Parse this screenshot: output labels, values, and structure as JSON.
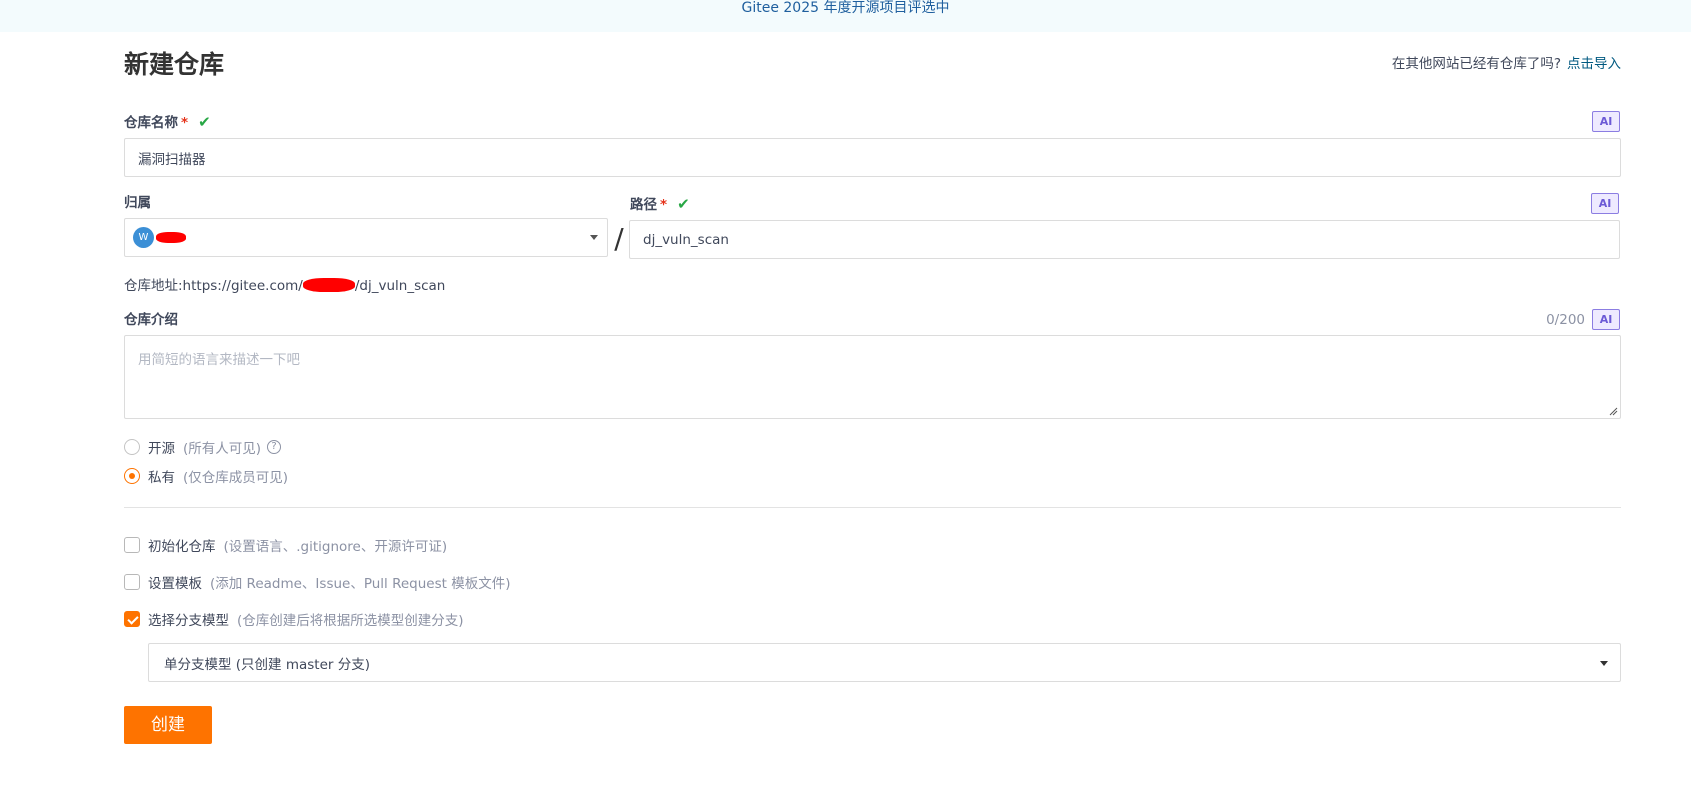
{
  "banner": {
    "text": "Gitee 2025 年度开源项目评选中"
  },
  "page": {
    "title": "新建仓库"
  },
  "import_hint": {
    "text": "在其他网站已经有仓库了吗?",
    "link": "点击导入"
  },
  "ai_badge": "AI",
  "repo_name": {
    "label": "仓库名称",
    "required_mark": "*",
    "check": "✔",
    "value": "漏洞扫描器"
  },
  "owner": {
    "label": "归属",
    "avatar_letter": "W"
  },
  "path_separator": "/",
  "path": {
    "label": "路径",
    "required_mark": "*",
    "check": "✔",
    "value": "dj_vuln_scan"
  },
  "repo_url": {
    "prefix": "仓库地址:https://gitee.com/",
    "suffix": "/dj_vuln_scan"
  },
  "description": {
    "label": "仓库介绍",
    "counter": "0/200",
    "placeholder": "用简短的语言来描述一下吧"
  },
  "visibility": {
    "options": [
      {
        "label": "开源",
        "hint": "(所有人可见)",
        "help": "?",
        "checked": false
      },
      {
        "label": "私有",
        "hint": "(仅仓库成员可见)",
        "checked": true
      }
    ]
  },
  "options": {
    "init_repo": {
      "label": "初始化仓库",
      "hint": "(设置语言、.gitignore、开源许可证)",
      "checked": false
    },
    "template": {
      "label": "设置模板",
      "hint": "(添加 Readme、Issue、Pull Request 模板文件)",
      "checked": false
    },
    "branch_model": {
      "label": "选择分支模型",
      "hint": "(仓库创建后将根据所选模型创建分支)",
      "checked": true
    }
  },
  "branch_select": {
    "value": "单分支模型 (只创建 master 分支)"
  },
  "create_button": {
    "label": "创建"
  },
  "colors": {
    "accent": "#fe7300",
    "link": "#005980",
    "success": "#28a745",
    "required": "#e5331b",
    "ai": "#6c5ad6"
  }
}
